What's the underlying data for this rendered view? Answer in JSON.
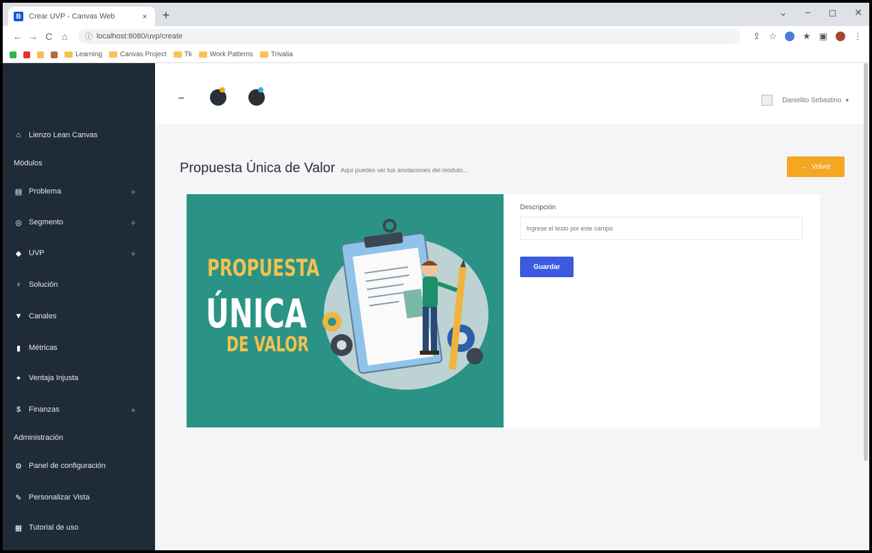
{
  "browser": {
    "tab_title": "Crear UVP - Canvas Web",
    "tab_favicon": "B",
    "url": "localhost:8080/uvp/create",
    "bookmarks": [
      "Learning",
      "Canvas Project",
      "Tk",
      "Work Patterns",
      "Trivalia"
    ]
  },
  "sidebar": {
    "brand": "Lienzo Lean Canvas",
    "section_modules": "Módulos",
    "items": [
      {
        "label": "Problema",
        "icon": "clipboard-icon",
        "expandable": true
      },
      {
        "label": "Segmento",
        "icon": "target-icon",
        "expandable": true
      },
      {
        "label": "UVP",
        "icon": "diamond-icon",
        "expandable": true
      },
      {
        "label": "Solución",
        "icon": "bulb-icon",
        "expandable": false
      },
      {
        "label": "Canales",
        "icon": "cart-icon",
        "expandable": false
      },
      {
        "label": "Métricas",
        "icon": "bar-chart-icon",
        "expandable": false
      },
      {
        "label": "Ventaja Injusta",
        "icon": "star-person-icon",
        "expandable": false
      },
      {
        "label": "Finanzas",
        "icon": "money-icon",
        "expandable": true
      }
    ],
    "section_admin": "Administración",
    "admin_items": [
      {
        "label": "Panel de configuración",
        "icon": "gear-icon"
      },
      {
        "label": "Personalizar Vista",
        "icon": "edit-icon"
      },
      {
        "label": "Tutorial de uso",
        "icon": "book-icon"
      }
    ]
  },
  "topbar": {
    "user_name": "Danielito Sebastino"
  },
  "page": {
    "title": "Propuesta Única de Valor",
    "subtitle": "Aquí puedes ver tus anotaciones del módulo...",
    "back_label": "Volver",
    "banner": {
      "line1": "PROPUESTA",
      "line2": "ÚNICA",
      "line3": "DE VALOR"
    },
    "form": {
      "label": "Descripción",
      "placeholder": "Ingrese el texto por este campo",
      "value": "",
      "save_label": "Guardar"
    }
  },
  "colors": {
    "sidebar_bg": "#1f2b36",
    "accent_orange": "#f5a623",
    "primary_blue": "#3c5ae0",
    "banner_teal": "#2a9385"
  }
}
